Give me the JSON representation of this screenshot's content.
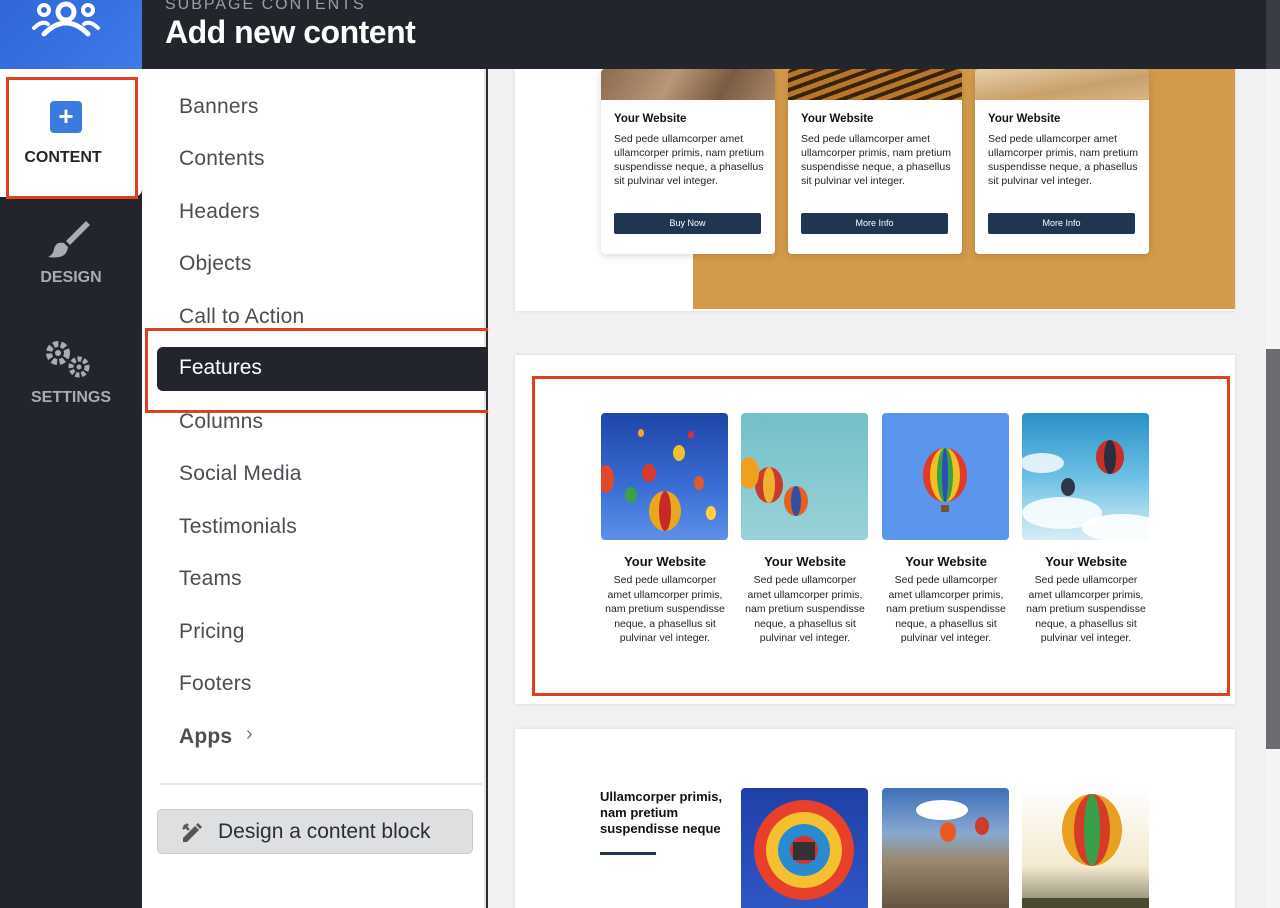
{
  "header": {
    "subtitle": "SUBPAGE CONTENTS",
    "title": "Add new content",
    "logo_icon": "people-group-icon"
  },
  "leftnav": {
    "items": [
      {
        "label": "CONTENT",
        "icon": "plus-square-icon",
        "active": true
      },
      {
        "label": "DESIGN",
        "icon": "paintbrush-icon",
        "active": false
      },
      {
        "label": "SETTINGS",
        "icon": "gears-icon",
        "active": false
      }
    ]
  },
  "categories": {
    "items": [
      "Banners",
      "Contents",
      "Headers",
      "Objects",
      "Call to Action",
      "Features",
      "Columns",
      "Social Media",
      "Testimonials",
      "Teams",
      "Pricing",
      "Footers"
    ],
    "active": "Features",
    "apps_label": "Apps",
    "design_button": "Design a content block"
  },
  "preview": {
    "cards": [
      {
        "title": "Your Website",
        "text": "Sed pede ullamcorper amet ullamcorper primis, nam pretium suspendisse neque, a phasellus sit pulvinar vel integer.",
        "button": "Buy Now"
      },
      {
        "title": "Your Website",
        "text": "Sed pede ullamcorper amet ullamcorper primis, nam pretium suspendisse neque, a phasellus sit pulvinar vel integer.",
        "button": "More Info"
      },
      {
        "title": "Your Website",
        "text": "Sed pede ullamcorper amet ullamcorper primis, nam pretium suspendisse neque, a phasellus sit pulvinar vel integer.",
        "button": "More Info"
      }
    ],
    "features": [
      {
        "title": "Your Website",
        "text": "Sed pede ullamcorper amet ullamcorper primis, nam pretium suspendisse neque, a phasellus sit pulvinar vel integer."
      },
      {
        "title": "Your Website",
        "text": "Sed pede ullamcorper amet ullamcorper primis, nam pretium suspendisse neque, a phasellus sit pulvinar vel integer."
      },
      {
        "title": "Your Website",
        "text": "Sed pede ullamcorper amet ullamcorper primis, nam pretium suspendisse neque, a phasellus sit pulvinar vel integer."
      },
      {
        "title": "Your Website",
        "text": "Sed pede ullamcorper amet ullamcorper primis, nam pretium suspendisse neque, a phasellus sit pulvinar vel integer."
      }
    ],
    "block3_heading": "Ullamcorper primis, nam pretium suspendisse neque"
  },
  "colors": {
    "accent": "#3b7be0",
    "dark": "#22252b",
    "highlight": "#e0401f",
    "button": "#1f3550",
    "gold": "#d39a4b"
  }
}
